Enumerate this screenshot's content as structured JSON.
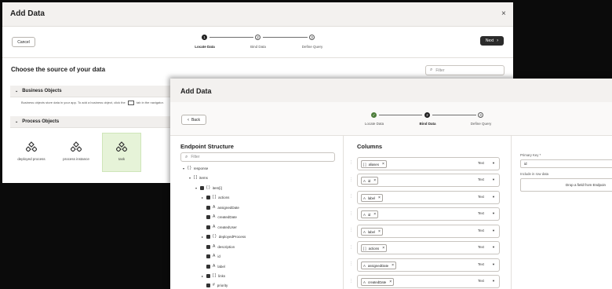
{
  "back_dialog": {
    "title": "Add Data",
    "close": "×",
    "cancel": "Cancel",
    "next": "Next",
    "steps": [
      {
        "num": "1",
        "label": "Locate Data"
      },
      {
        "num": "2",
        "label": "Bind Data"
      },
      {
        "num": "3",
        "label": "Define Query"
      }
    ],
    "heading": "Choose the source of your data",
    "filter_placeholder": "Filter",
    "business_objects": {
      "title": "Business Objects",
      "desc": "Business objects store data in your app. To add a business object, click the",
      "desc_tail": "tab in the navigator."
    },
    "process_objects": {
      "title": "Process Objects",
      "tiles": [
        "deployed process",
        "process instance",
        "task"
      ]
    }
  },
  "front_dialog": {
    "title": "Add Data",
    "back": "Back",
    "steps": [
      {
        "num": "✓",
        "label": "Locate Data"
      },
      {
        "num": "2",
        "label": "Bind Data"
      },
      {
        "num": "3",
        "label": "Define Query"
      }
    ],
    "endpoint": {
      "title": "Endpoint Structure",
      "filter_placeholder": "Filter",
      "tree": [
        {
          "icon": "{ }",
          "label": "response"
        },
        {
          "icon": "[ ]",
          "label": "items"
        },
        {
          "icon": "{ }",
          "label": "item[i]"
        },
        {
          "icon": "[ ]",
          "label": "actions"
        },
        {
          "icon": "A",
          "label": "assignedDate"
        },
        {
          "icon": "A",
          "label": "createdDate"
        },
        {
          "icon": "A",
          "label": "createdUser"
        },
        {
          "icon": "{ }",
          "label": "deployedProcess"
        },
        {
          "icon": "A",
          "label": "description"
        },
        {
          "icon": "A",
          "label": "id"
        },
        {
          "icon": "A",
          "label": "label"
        },
        {
          "icon": "[ ]",
          "label": "links"
        },
        {
          "icon": "#",
          "label": "priority"
        }
      ]
    },
    "columns": {
      "title": "Columns",
      "type_label": "Text",
      "rows": [
        {
          "icon": "[ ]",
          "name": "aliases"
        },
        {
          "icon": "A",
          "name": "id"
        },
        {
          "icon": "A",
          "name": "label"
        },
        {
          "icon": "A",
          "name": "id"
        },
        {
          "icon": "A",
          "name": "label"
        },
        {
          "icon": "[ ]",
          "name": "actions"
        },
        {
          "icon": "A",
          "name": "assignedDate"
        },
        {
          "icon": "A",
          "name": "createdDate"
        }
      ]
    },
    "right": {
      "primary_key_label": "Primary Key *",
      "primary_key_value": "id",
      "include_label": "Include in row data",
      "drop_text": "Drop a field from Endpoin"
    }
  }
}
